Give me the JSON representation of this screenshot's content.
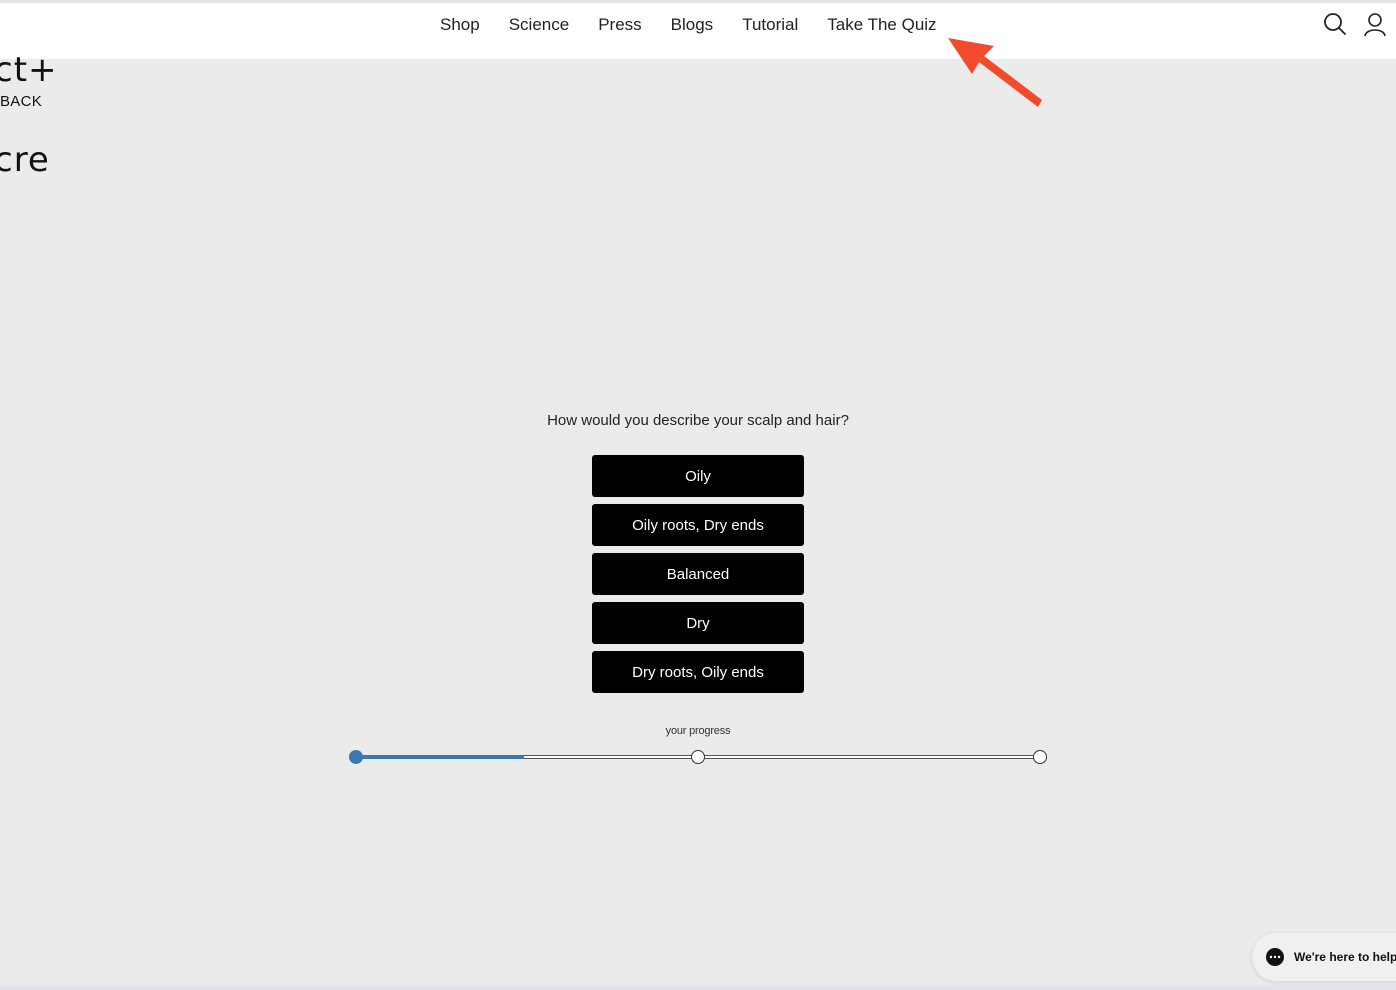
{
  "header": {
    "logo_line1": "ct+",
    "logo_line2": "cre",
    "nav": [
      {
        "label": "Shop"
      },
      {
        "label": "Science"
      },
      {
        "label": "Press"
      },
      {
        "label": "Blogs"
      },
      {
        "label": "Tutorial"
      },
      {
        "label": "Take The Quiz"
      }
    ],
    "icons": [
      "search-icon",
      "account-icon"
    ]
  },
  "back_label": "BACK",
  "quiz": {
    "question": "How would you describe your scalp and hair?",
    "options": [
      {
        "label": "Oily"
      },
      {
        "label": "Oily roots, Dry ends"
      },
      {
        "label": "Balanced"
      },
      {
        "label": "Dry"
      },
      {
        "label": "Dry roots, Oily ends"
      }
    ]
  },
  "progress": {
    "label": "your progress",
    "fraction": 0.245,
    "fill_color": "#3a79b0"
  },
  "chat": {
    "label": "We're here to help"
  },
  "annotation": {
    "arrow_color": "#f24a2a"
  },
  "colors": {
    "background": "#ebebeb",
    "button": "#000000",
    "accent": "#3a79b0"
  }
}
